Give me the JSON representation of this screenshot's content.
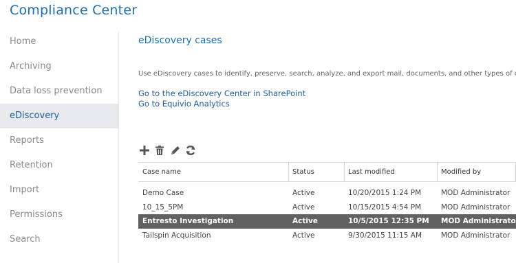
{
  "app": {
    "title": "Compliance Center"
  },
  "sidebar": {
    "items": [
      {
        "label": "Home"
      },
      {
        "label": "Archiving"
      },
      {
        "label": "Data loss prevention"
      },
      {
        "label": "eDiscovery",
        "active": true
      },
      {
        "label": "Reports"
      },
      {
        "label": "Retention"
      },
      {
        "label": "Import"
      },
      {
        "label": "Permissions"
      },
      {
        "label": "Search"
      }
    ]
  },
  "main": {
    "title": "eDiscovery cases",
    "description": "Use eDiscovery cases to identify, preserve, search, analyze, and export mail, documents, and other types of cont",
    "links": [
      {
        "label": "Go to the eDiscovery Center in SharePoint"
      },
      {
        "label": "Go to Equivio Analytics"
      }
    ],
    "toolbar": {
      "icons": [
        "plus-icon",
        "trash-icon",
        "pencil-icon",
        "refresh-icon"
      ]
    },
    "table": {
      "columns": [
        "Case name",
        "Status",
        "Last modified",
        "Modified by"
      ],
      "rows": [
        {
          "name": "Demo Case",
          "status": "Active",
          "modified": "10/20/2015 1:24 PM",
          "by": "MOD Administrator",
          "selected": false
        },
        {
          "name": "10_15_5PM",
          "status": "Active",
          "modified": "10/15/2015 4:54 PM",
          "by": "MOD Administrator",
          "selected": false
        },
        {
          "name": "Entresto Investigation",
          "status": "Active",
          "modified": "10/5/2015 12:35 PM",
          "by": "MOD Administrator",
          "selected": true
        },
        {
          "name": "Tailspin Acquisition",
          "status": "Active",
          "modified": "9/30/2015 11:15 AM",
          "by": "MOD Administrator",
          "selected": false
        }
      ]
    }
  },
  "colors": {
    "accent": "#1a6fb5",
    "nav_active_bg": "#e7e9ec",
    "row_selected_bg": "#616161"
  }
}
